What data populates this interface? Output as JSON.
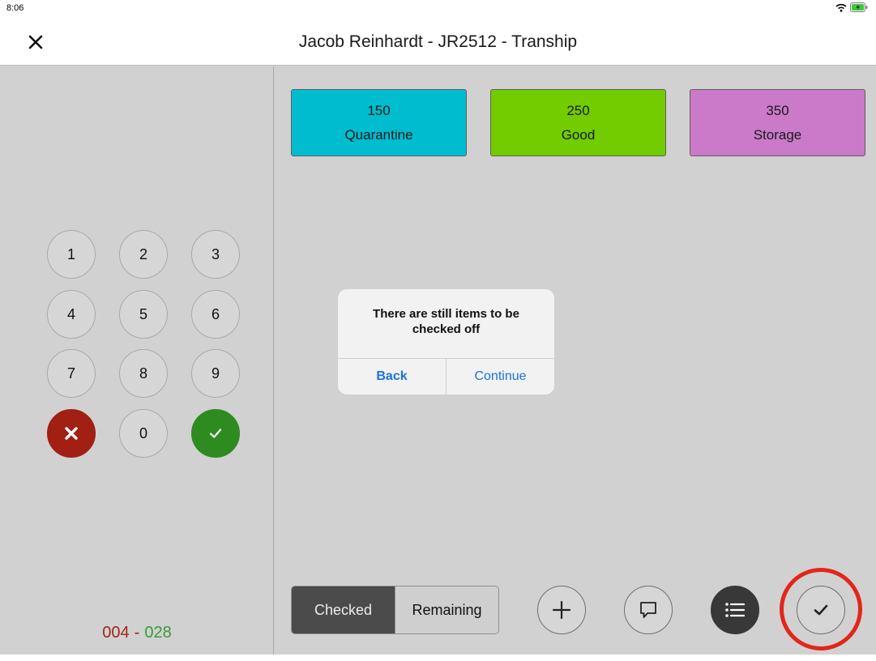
{
  "status_bar": {
    "time": "8:06"
  },
  "header": {
    "title": "Jacob Reinhardt - JR2512 - Tranship"
  },
  "categories": [
    {
      "number": "150",
      "label": "Quarantine",
      "color": "#00bccf"
    },
    {
      "number": "250",
      "label": "Good",
      "color": "#72cc00"
    },
    {
      "number": "350",
      "label": "Storage",
      "color": "#ca7ac8"
    }
  ],
  "keypad": {
    "keys": [
      "1",
      "2",
      "3",
      "4",
      "5",
      "6",
      "7",
      "8",
      "9",
      "0"
    ]
  },
  "counter": {
    "checked": "004",
    "separator": "-",
    "total": "028"
  },
  "dialog": {
    "message": "There are still items to be checked off",
    "back_label": "Back",
    "continue_label": "Continue"
  },
  "segment": {
    "checked_label": "Checked",
    "remaining_label": "Remaining",
    "selected": "Checked"
  },
  "toolbar": {
    "icons": [
      "plus-icon",
      "comment-icon",
      "list-icon",
      "checkmark-icon"
    ]
  }
}
